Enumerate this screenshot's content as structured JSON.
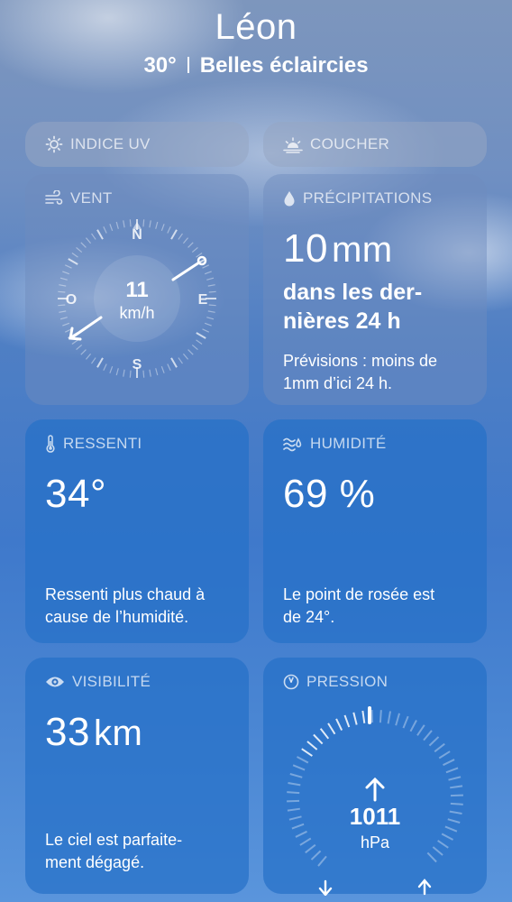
{
  "header": {
    "city": "Léon",
    "temperature": "30°",
    "condition": "Belles éclaircies"
  },
  "uv": {
    "label": "INDICE UV"
  },
  "sunset": {
    "label": "COUCHER"
  },
  "wind": {
    "label": "VENT",
    "speed": "11",
    "unit": "km/h",
    "north": "N",
    "south": "S",
    "east": "E",
    "west": "O"
  },
  "precipitation": {
    "label": "PRÉCIPITATIONS",
    "value": "10",
    "unit": "mm",
    "period_line1": "dans les der-",
    "period_line2": "nières 24 h",
    "forecast_line1": "Prévisions : moins de",
    "forecast_line2": "1mm d’ici 24 h."
  },
  "feels_like": {
    "label": "RESSENTI",
    "value": "34°",
    "desc_line1": "Ressenti plus chaud à",
    "desc_line2": "cause de l’humidité."
  },
  "humidity": {
    "label": "HUMIDITÉ",
    "value": "69 %",
    "desc_line1": "Le point de rosée est",
    "desc_line2": "de 24°."
  },
  "visibility": {
    "label": "VISIBILITÉ",
    "value": "33",
    "unit": "km",
    "desc_line1": "Le ciel est parfaite-",
    "desc_line2": "ment dégagé."
  },
  "pressure": {
    "label": "PRESSION",
    "value": "1011",
    "unit": "hPa"
  },
  "icons": [
    "sun-icon",
    "sunset-icon",
    "wind-icon",
    "raindrop-icon",
    "thermometer-icon",
    "humidity-icon",
    "eye-icon",
    "pressure-gauge-icon",
    "compass-arrow-icon",
    "pressure-trend-up-icon",
    "pressure-low-arrow-icon",
    "pressure-high-arrow-icon"
  ]
}
